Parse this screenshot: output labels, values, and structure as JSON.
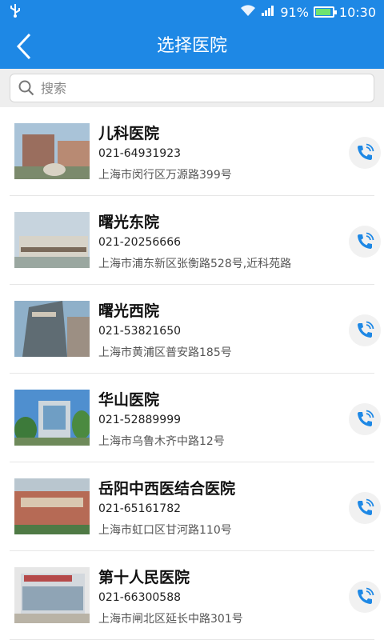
{
  "status": {
    "battery": "91%",
    "time": "10:30",
    "battery_level": 0.91
  },
  "header": {
    "title": "选择医院"
  },
  "search": {
    "placeholder": "搜索"
  },
  "hospitals": [
    {
      "name": "儿科医院",
      "phone": "021-64931923",
      "address": "上海市闵行区万源路399号"
    },
    {
      "name": "曙光东院",
      "phone": "021-20256666",
      "address": " 上海市浦东新区张衡路528号,近科苑路"
    },
    {
      "name": "曙光西院",
      "phone": "021-53821650",
      "address": " 上海市黄浦区普安路185号"
    },
    {
      "name": "华山医院",
      "phone": "021-52889999",
      "address": "上海市乌鲁木齐中路12号"
    },
    {
      "name": "岳阳中西医结合医院",
      "phone": "021-65161782",
      "address": "上海市虹口区甘河路110号"
    },
    {
      "name": "第十人民医院",
      "phone": "021-66300588",
      "address": "上海市闸北区延长中路301号"
    }
  ],
  "colors": {
    "primary": "#1e88e5",
    "call_icon": "#1e88e5"
  }
}
